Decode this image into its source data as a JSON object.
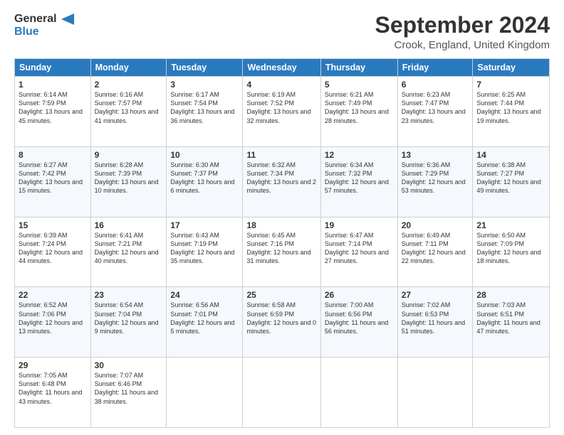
{
  "header": {
    "logo_line1": "General",
    "logo_line2": "Blue",
    "title": "September 2024",
    "subtitle": "Crook, England, United Kingdom"
  },
  "days": [
    "Sunday",
    "Monday",
    "Tuesday",
    "Wednesday",
    "Thursday",
    "Friday",
    "Saturday"
  ],
  "rows": [
    [
      {
        "day": "1",
        "sunrise": "Sunrise: 6:14 AM",
        "sunset": "Sunset: 7:59 PM",
        "daylight": "Daylight: 13 hours and 45 minutes."
      },
      {
        "day": "2",
        "sunrise": "Sunrise: 6:16 AM",
        "sunset": "Sunset: 7:57 PM",
        "daylight": "Daylight: 13 hours and 41 minutes."
      },
      {
        "day": "3",
        "sunrise": "Sunrise: 6:17 AM",
        "sunset": "Sunset: 7:54 PM",
        "daylight": "Daylight: 13 hours and 36 minutes."
      },
      {
        "day": "4",
        "sunrise": "Sunrise: 6:19 AM",
        "sunset": "Sunset: 7:52 PM",
        "daylight": "Daylight: 13 hours and 32 minutes."
      },
      {
        "day": "5",
        "sunrise": "Sunrise: 6:21 AM",
        "sunset": "Sunset: 7:49 PM",
        "daylight": "Daylight: 13 hours and 28 minutes."
      },
      {
        "day": "6",
        "sunrise": "Sunrise: 6:23 AM",
        "sunset": "Sunset: 7:47 PM",
        "daylight": "Daylight: 13 hours and 23 minutes."
      },
      {
        "day": "7",
        "sunrise": "Sunrise: 6:25 AM",
        "sunset": "Sunset: 7:44 PM",
        "daylight": "Daylight: 13 hours and 19 minutes."
      }
    ],
    [
      {
        "day": "8",
        "sunrise": "Sunrise: 6:27 AM",
        "sunset": "Sunset: 7:42 PM",
        "daylight": "Daylight: 13 hours and 15 minutes."
      },
      {
        "day": "9",
        "sunrise": "Sunrise: 6:28 AM",
        "sunset": "Sunset: 7:39 PM",
        "daylight": "Daylight: 13 hours and 10 minutes."
      },
      {
        "day": "10",
        "sunrise": "Sunrise: 6:30 AM",
        "sunset": "Sunset: 7:37 PM",
        "daylight": "Daylight: 13 hours and 6 minutes."
      },
      {
        "day": "11",
        "sunrise": "Sunrise: 6:32 AM",
        "sunset": "Sunset: 7:34 PM",
        "daylight": "Daylight: 13 hours and 2 minutes."
      },
      {
        "day": "12",
        "sunrise": "Sunrise: 6:34 AM",
        "sunset": "Sunset: 7:32 PM",
        "daylight": "Daylight: 12 hours and 57 minutes."
      },
      {
        "day": "13",
        "sunrise": "Sunrise: 6:36 AM",
        "sunset": "Sunset: 7:29 PM",
        "daylight": "Daylight: 12 hours and 53 minutes."
      },
      {
        "day": "14",
        "sunrise": "Sunrise: 6:38 AM",
        "sunset": "Sunset: 7:27 PM",
        "daylight": "Daylight: 12 hours and 49 minutes."
      }
    ],
    [
      {
        "day": "15",
        "sunrise": "Sunrise: 6:39 AM",
        "sunset": "Sunset: 7:24 PM",
        "daylight": "Daylight: 12 hours and 44 minutes."
      },
      {
        "day": "16",
        "sunrise": "Sunrise: 6:41 AM",
        "sunset": "Sunset: 7:21 PM",
        "daylight": "Daylight: 12 hours and 40 minutes."
      },
      {
        "day": "17",
        "sunrise": "Sunrise: 6:43 AM",
        "sunset": "Sunset: 7:19 PM",
        "daylight": "Daylight: 12 hours and 35 minutes."
      },
      {
        "day": "18",
        "sunrise": "Sunrise: 6:45 AM",
        "sunset": "Sunset: 7:16 PM",
        "daylight": "Daylight: 12 hours and 31 minutes."
      },
      {
        "day": "19",
        "sunrise": "Sunrise: 6:47 AM",
        "sunset": "Sunset: 7:14 PM",
        "daylight": "Daylight: 12 hours and 27 minutes."
      },
      {
        "day": "20",
        "sunrise": "Sunrise: 6:49 AM",
        "sunset": "Sunset: 7:11 PM",
        "daylight": "Daylight: 12 hours and 22 minutes."
      },
      {
        "day": "21",
        "sunrise": "Sunrise: 6:50 AM",
        "sunset": "Sunset: 7:09 PM",
        "daylight": "Daylight: 12 hours and 18 minutes."
      }
    ],
    [
      {
        "day": "22",
        "sunrise": "Sunrise: 6:52 AM",
        "sunset": "Sunset: 7:06 PM",
        "daylight": "Daylight: 12 hours and 13 minutes."
      },
      {
        "day": "23",
        "sunrise": "Sunrise: 6:54 AM",
        "sunset": "Sunset: 7:04 PM",
        "daylight": "Daylight: 12 hours and 9 minutes."
      },
      {
        "day": "24",
        "sunrise": "Sunrise: 6:56 AM",
        "sunset": "Sunset: 7:01 PM",
        "daylight": "Daylight: 12 hours and 5 minutes."
      },
      {
        "day": "25",
        "sunrise": "Sunrise: 6:58 AM",
        "sunset": "Sunset: 6:59 PM",
        "daylight": "Daylight: 12 hours and 0 minutes."
      },
      {
        "day": "26",
        "sunrise": "Sunrise: 7:00 AM",
        "sunset": "Sunset: 6:56 PM",
        "daylight": "Daylight: 11 hours and 56 minutes."
      },
      {
        "day": "27",
        "sunrise": "Sunrise: 7:02 AM",
        "sunset": "Sunset: 6:53 PM",
        "daylight": "Daylight: 11 hours and 51 minutes."
      },
      {
        "day": "28",
        "sunrise": "Sunrise: 7:03 AM",
        "sunset": "Sunset: 6:51 PM",
        "daylight": "Daylight: 11 hours and 47 minutes."
      }
    ],
    [
      {
        "day": "29",
        "sunrise": "Sunrise: 7:05 AM",
        "sunset": "Sunset: 6:48 PM",
        "daylight": "Daylight: 11 hours and 43 minutes."
      },
      {
        "day": "30",
        "sunrise": "Sunrise: 7:07 AM",
        "sunset": "Sunset: 6:46 PM",
        "daylight": "Daylight: 11 hours and 38 minutes."
      },
      null,
      null,
      null,
      null,
      null
    ]
  ]
}
